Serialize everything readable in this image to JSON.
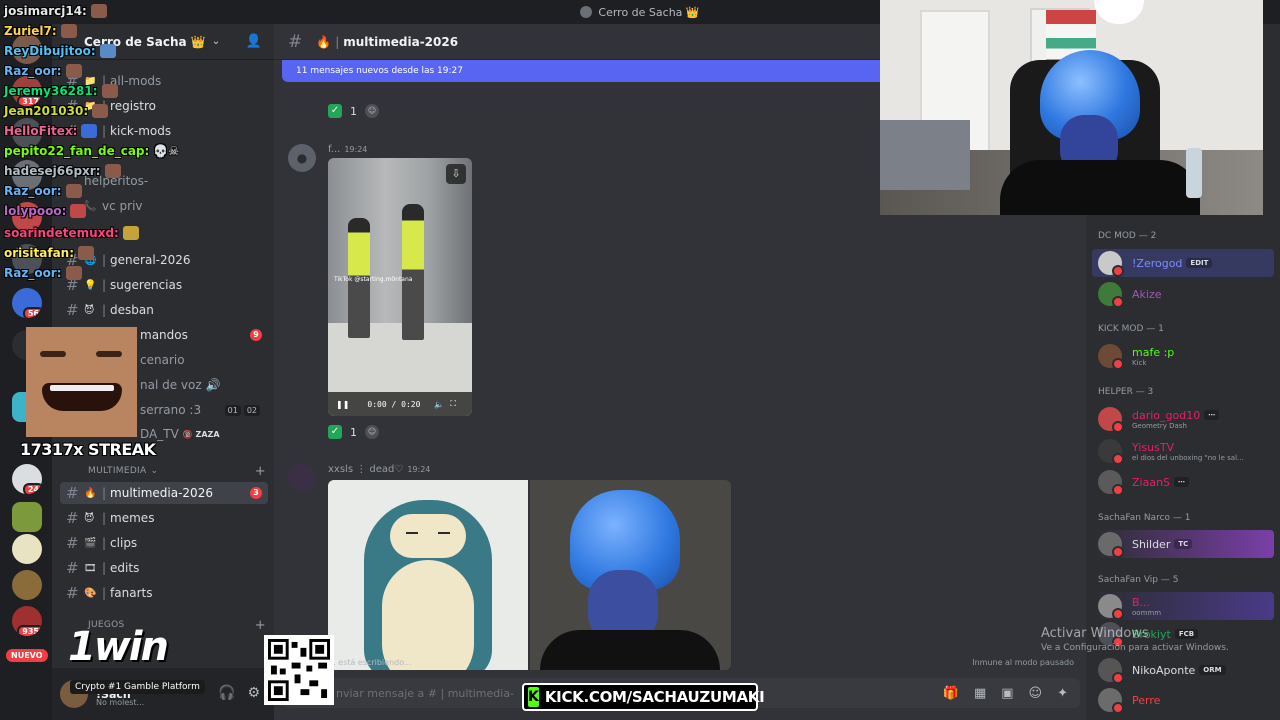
{
  "window": {
    "title": "Cerro de Sacha 👑"
  },
  "server": {
    "name": "Cerro de Sacha 👑"
  },
  "sidebar": {
    "channels": [
      {
        "label": "all-mods",
        "emoji": "📁"
      },
      {
        "label": "registro",
        "emoji": "📁"
      },
      {
        "label": "kick-mods",
        "emoji": "🟩"
      },
      {
        "label": "helperitos-",
        "emoji": ""
      },
      {
        "label": "vc priv",
        "emoji": "📞"
      },
      {
        "label": "general-2026",
        "emoji": "🌐"
      },
      {
        "label": "sugerencias",
        "emoji": "💡"
      },
      {
        "label": "desban",
        "emoji": "😈"
      },
      {
        "label": "mandos",
        "emoji": "",
        "badge": "9"
      },
      {
        "label": "cenario",
        "emoji": ""
      },
      {
        "label": "nal de voz 🔊",
        "emoji": ""
      },
      {
        "label": "serrano :3",
        "emoji": "",
        "users": [
          "01",
          "02"
        ]
      },
      {
        "label": "DA_TV",
        "emoji": "",
        "extra": "🔞 ZAZA"
      },
      {
        "label": "multimedia-2026",
        "emoji": "🔥",
        "badge": "3"
      },
      {
        "label": "memes",
        "emoji": "😈"
      },
      {
        "label": "clips",
        "emoji": "🎬"
      },
      {
        "label": "edits",
        "emoji": "🎞"
      },
      {
        "label": "fanarts",
        "emoji": "🎨"
      }
    ],
    "categories": {
      "multimedia": "MULTIMEDIA",
      "juegos": "JUEGOS"
    },
    "user": {
      "name": "!Sach",
      "status": "No molest..."
    }
  },
  "servers": {
    "badges": [
      "317",
      "56",
      "24",
      "935"
    ],
    "nuevo": "NUEVO"
  },
  "chat": {
    "channel": "multimedia-2026",
    "channel_emoji": "🔥",
    "new_messages": "11 mensajes nuevos desde las 19:27",
    "reaction_count": "1",
    "messages": [
      {
        "author": "f...",
        "time": "19:24"
      },
      {
        "author": "xxsls ⋮ dead♡",
        "time": "19:24"
      }
    ],
    "video": {
      "time": "0:00 / 0:20",
      "watermark": "TikTok\n@starting.m0ntana"
    },
    "typing": "... está escribiendo...",
    "paused": "Inmune al modo pausado",
    "composer_placeholder": "nviar mensaje a # | multimedia-"
  },
  "members": {
    "groups": [
      {
        "role": "DC MOD — 2",
        "items": [
          {
            "name": "!Zerogod",
            "tag": "EDIT",
            "color": "#5865f2"
          },
          {
            "name": "Akize",
            "color": "#9b59b6"
          }
        ]
      },
      {
        "role": "KICK MOD — 1",
        "items": [
          {
            "name": "mafe :p",
            "sub": "Kick",
            "color": "#53fc18"
          }
        ]
      },
      {
        "role": "HELPER — 3",
        "items": [
          {
            "name": "dario_god10",
            "tag": "⋯",
            "sub": "Geometry Dash",
            "color": "#e91e63"
          },
          {
            "name": "YisusTV",
            "sub": "el dios del unboxing \"no le sal...",
            "color": "#e91e63"
          },
          {
            "name": "ZiaanS",
            "tag": "⋯",
            "color": "#e91e63"
          }
        ]
      },
      {
        "role": "SachaFan Narco — 1",
        "items": [
          {
            "name": "Shilder",
            "tag": "TC",
            "color": "#dbdee1"
          }
        ]
      },
      {
        "role": "SachaFan Vip — 5",
        "items": [
          {
            "name": "B...",
            "sub": "oommm",
            "color": "#e91e63"
          },
          {
            "name": "Brokiyt",
            "tag": "FCB",
            "color": "#23a55a"
          },
          {
            "name": "NikoAponte",
            "tag": "ORM",
            "color": "#dbdee1"
          },
          {
            "name": "Perre",
            "color": "#f23f43"
          }
        ]
      }
    ]
  },
  "overlay": {
    "chat_lines": [
      {
        "user": "josimarcj14:",
        "color": "#e6e6e6"
      },
      {
        "user": "Zuriel7:",
        "color": "#ffd54f"
      },
      {
        "user": "ReyDibujitoo:",
        "color": "#4fc3f7"
      },
      {
        "user": "Raz_oor:",
        "color": "#64b5f6"
      },
      {
        "user": "Jeremy36281:",
        "color": "#00e676"
      },
      {
        "user": "Jean201030:",
        "color": "#cddc39"
      },
      {
        "user": "HelloFitex:",
        "color": "#f06292"
      },
      {
        "user": "pepito22_fan_de_cap:",
        "color": "#76ff03",
        "text": "💀☠"
      },
      {
        "user": "hadesej66pxr:",
        "color": "#b0bec5"
      },
      {
        "user": "Raz_oor:",
        "color": "#64b5f6"
      },
      {
        "user": "lolypooo:",
        "color": "#ba68c8"
      },
      {
        "user": "soarindetemuxd:",
        "color": "#ff4081"
      },
      {
        "user": "orisitafan:",
        "color": "#ffee58"
      },
      {
        "user": "Raz_oor:",
        "color": "#64b5f6"
      }
    ],
    "streak": "17317x STREAK",
    "onewin": "1win",
    "onewin_sub": "Crypto #1 Gamble Platform",
    "kick_url": "KICK.COM/SACHAUZUMAKI",
    "activate_title": "Activar Windows",
    "activate_sub": "Ve a Configuración para activar Windows."
  }
}
